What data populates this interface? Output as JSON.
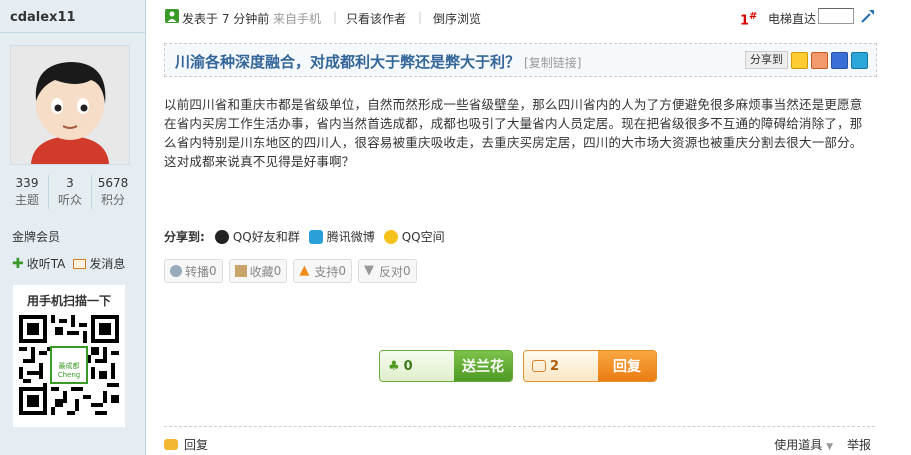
{
  "user": {
    "name": "cdalex11",
    "stats": [
      {
        "num": "339",
        "label": "主题"
      },
      {
        "num": "3",
        "label": "听众"
      },
      {
        "num": "5678",
        "label": "积分"
      }
    ],
    "rank": "金牌会员",
    "follow_label": "收听TA",
    "message_label": "发消息",
    "qr_title": "用手机扫描一下",
    "qr_center_text": "最成都",
    "qr_center_sub": "Cheng"
  },
  "topbar": {
    "posted": "发表于 7 分钟前",
    "source": "来自手机",
    "author_only": "只看该作者",
    "reverse": "倒序浏览",
    "floor": "1",
    "floor_mark": "#",
    "jump_label": "电梯直达"
  },
  "post": {
    "title": "川渝各种深度融合，对成都利大于弊还是弊大于利？",
    "copy_link": "[复制链接]",
    "share_to": "分享到",
    "body": "以前四川省和重庆市都是省级单位，自然而然形成一些省级壁垒，那么四川省内的人为了方便避免很多麻烦事当然还是更愿意在省内买房工作生活办事，省内当然首选成都，成都也吸引了大量省内人员定居。现在把省级很多不互通的障碍给消除了，那么省内特别是川东地区的四川人，很容易被重庆吸收走，去重庆买房定居，四川的大市场大资源也被重庆分割去很大一部分。这对成都来说真不见得是好事啊？"
  },
  "share": {
    "label": "分享到:",
    "items": [
      "QQ好友和群",
      "腾讯微博",
      "QQ空间"
    ]
  },
  "actions": {
    "forward": "转播",
    "forward_count": "0",
    "favorite": "收藏",
    "favorite_count": "0",
    "support": "支持",
    "support_count": "0",
    "oppose": "反对",
    "oppose_count": "0"
  },
  "buttons": {
    "flower_count": "0",
    "flower_label": "送兰花",
    "reply_count": "2",
    "reply_label": "回复"
  },
  "bottom": {
    "reply": "回复",
    "tools": "使用道具",
    "report": "举报"
  }
}
